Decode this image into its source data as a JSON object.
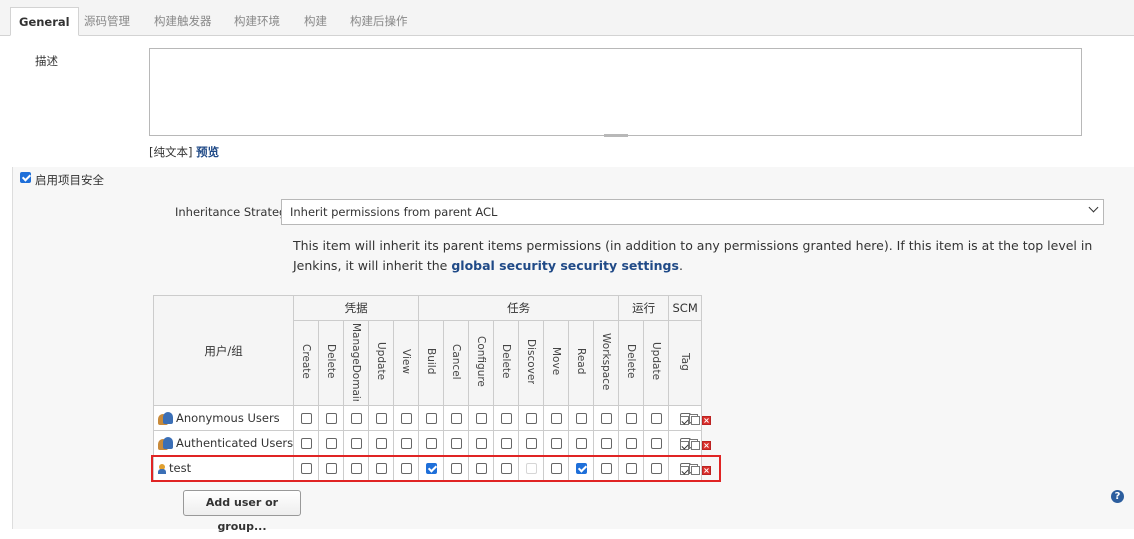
{
  "tabs": [
    "General",
    "源码管理",
    "构建触发器",
    "构建环境",
    "构建",
    "构建后操作"
  ],
  "description": {
    "label": "描述",
    "value": "",
    "plain_text": "[纯文本]",
    "preview": "预览"
  },
  "security": {
    "enable_label": "启用项目安全",
    "enabled": true
  },
  "inheritance": {
    "label": "Inheritance Strategy",
    "selected": "Inherit permissions from parent ACL",
    "info_text": "This item will inherit its parent items permissions (in addition to any permissions granted here). If this item is at the top level in Jenkins, it will inherit the ",
    "info_link": "global security security settings",
    "info_end": "."
  },
  "matrix": {
    "user_col": "用户/组",
    "groups": [
      {
        "name": "凭据",
        "span": 5
      },
      {
        "name": "任务",
        "span": 8
      },
      {
        "name": "运行",
        "span": 2
      },
      {
        "name": "SCM",
        "span": 1
      }
    ],
    "permissions": [
      "Create",
      "Delete",
      "ManageDomains",
      "Update",
      "View",
      "Build",
      "Cancel",
      "Configure",
      "Delete",
      "Discover",
      "Move",
      "Read",
      "Workspace",
      "Delete",
      "Update",
      "Tag"
    ],
    "rows": [
      {
        "name": "Anonymous Users",
        "icon": "user-group-icon",
        "checked": [],
        "disabled": []
      },
      {
        "name": "Authenticated Users",
        "icon": "user-group-icon",
        "checked": [],
        "disabled": []
      },
      {
        "name": "test",
        "icon": "user-icon",
        "checked": [
          5,
          11
        ],
        "disabled": [
          9
        ]
      }
    ]
  },
  "add_button": "Add user or group...",
  "colors": {
    "accent": "#1e6fd9",
    "highlight": "#e02424",
    "link": "#204a87"
  }
}
